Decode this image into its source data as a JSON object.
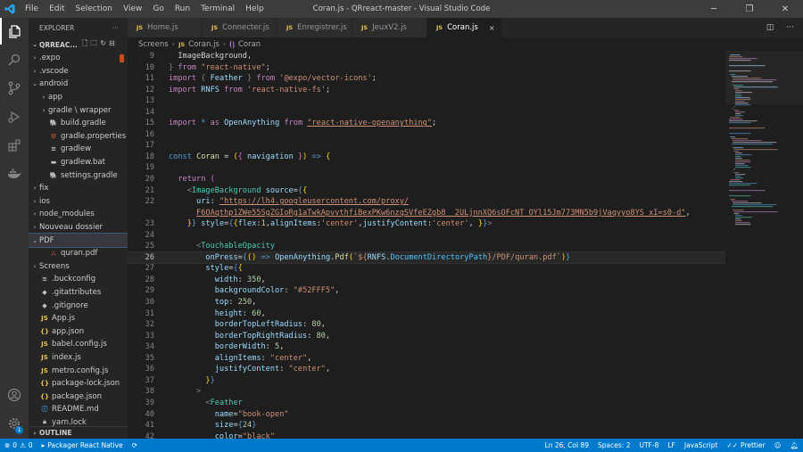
{
  "window": {
    "title": "Coran.js - QRreact-master - Visual Studio Code"
  },
  "menu": [
    "File",
    "Edit",
    "Selection",
    "View",
    "Go",
    "Run",
    "Terminal",
    "Help"
  ],
  "sidebar": {
    "header": "EXPLORER",
    "more": "···",
    "project": "QRREAC...",
    "items": [
      {
        "label": ".expo",
        "indent": 1,
        "kind": "folder",
        "open": false
      },
      {
        "label": ".vscode",
        "indent": 1,
        "kind": "folder",
        "open": false
      },
      {
        "label": "android",
        "indent": 1,
        "kind": "folder",
        "open": true
      },
      {
        "label": "app",
        "indent": 2,
        "kind": "folder",
        "open": false
      },
      {
        "label": "gradle \\ wrapper",
        "indent": 2,
        "kind": "folder",
        "open": false
      },
      {
        "label": "build.gradle",
        "indent": 2,
        "kind": "gradle"
      },
      {
        "label": "gradle.properties",
        "indent": 2,
        "kind": "gradle-props"
      },
      {
        "label": "gradlew",
        "indent": 2,
        "kind": "lines"
      },
      {
        "label": "gradlew.bat",
        "indent": 2,
        "kind": "bat"
      },
      {
        "label": "settings.gradle",
        "indent": 2,
        "kind": "gradle"
      },
      {
        "label": "fix",
        "indent": 1,
        "kind": "folder",
        "open": false
      },
      {
        "label": "ios",
        "indent": 1,
        "kind": "folder",
        "open": false
      },
      {
        "label": "node_modules",
        "indent": 1,
        "kind": "folder",
        "open": false
      },
      {
        "label": "Nouveau dossier",
        "indent": 1,
        "kind": "folder",
        "open": false
      },
      {
        "label": "PDF",
        "indent": 1,
        "kind": "folder",
        "open": true,
        "selected": true
      },
      {
        "label": "quran.pdf",
        "indent": 2,
        "kind": "pdf"
      },
      {
        "label": "Screens",
        "indent": 1,
        "kind": "folder",
        "open": false
      },
      {
        "label": ".buckconfig",
        "indent": 1,
        "kind": "lines"
      },
      {
        "label": ".gitattributes",
        "indent": 1,
        "kind": "git"
      },
      {
        "label": ".gitignore",
        "indent": 1,
        "kind": "git"
      },
      {
        "label": "App.js",
        "indent": 1,
        "kind": "js"
      },
      {
        "label": "app.json",
        "indent": 1,
        "kind": "json"
      },
      {
        "label": "babel.config.js",
        "indent": 1,
        "kind": "js"
      },
      {
        "label": "index.js",
        "indent": 1,
        "kind": "js"
      },
      {
        "label": "metro.config.js",
        "indent": 1,
        "kind": "js"
      },
      {
        "label": "package-lock.json",
        "indent": 1,
        "kind": "json"
      },
      {
        "label": "package.json",
        "indent": 1,
        "kind": "json"
      },
      {
        "label": "README.md",
        "indent": 1,
        "kind": "md"
      },
      {
        "label": "yarn.lock",
        "indent": 1,
        "kind": "yarn"
      }
    ],
    "outline": "OUTLINE"
  },
  "tabs": [
    {
      "label": "Home.js",
      "active": false
    },
    {
      "label": "Connecter.js",
      "active": false
    },
    {
      "label": "Enregistrer.js",
      "active": false
    },
    {
      "label": "JeuxV2.js",
      "active": false
    },
    {
      "label": "Coran.js",
      "active": true
    }
  ],
  "tab_icon_label": "JS",
  "tab_close": "×",
  "breadcrumb": [
    "Screens",
    "Coran.js",
    "Coran"
  ],
  "editor": {
    "current_line": 26,
    "lines": [
      {
        "n": "9",
        "html": "  ImageBackground,"
      },
      {
        "n": "10",
        "html": "<span class='p'>}</span> <span class='k'>from</span> <span class='s'>\"react-native\"</span>;"
      },
      {
        "n": "11",
        "html": "<span class='k'>import</span> <span class='p'>{</span> <span class='a'>Feather</span> <span class='p'>}</span> <span class='k'>from</span> <span class='s'>'@expo/vector-icons'</span>;"
      },
      {
        "n": "12",
        "html": "<span class='k'>import</span> <span class='a'>RNFS</span> <span class='k'>from</span> <span class='s'>'react-native-fs'</span>;"
      },
      {
        "n": "13",
        "html": ""
      },
      {
        "n": "14",
        "html": ""
      },
      {
        "n": "15",
        "html": "<span class='k'>import</span> <span class='kb'>*</span> <span class='k'>as</span> <span class='a'>OpenAnything</span> <span class='k'>from</span> <span class='s u'>\"react-native-openanything\"</span>;"
      },
      {
        "n": "16",
        "html": ""
      },
      {
        "n": "17",
        "html": ""
      },
      {
        "n": "18",
        "html": "<span class='kb'>const</span> <span class='f'>Coran</span> = <span class='y'>(</span><span class='pu'>{</span> <span class='a'>navigation</span> <span class='pu'>}</span><span class='y'>)</span> <span class='kb'>=&gt;</span> <span class='y'>{</span>"
      },
      {
        "n": "19",
        "html": ""
      },
      {
        "n": "20",
        "html": "  <span class='k'>return</span> <span class='pu'>(</span>"
      },
      {
        "n": "21",
        "html": "    <span class='p'>&lt;</span><span class='t'>ImageBackground</span> <span class='a'>source</span>=<span class='kb'>{</span><span class='y'>{</span>"
      },
      {
        "n": "22",
        "html": "      <span class='a'>uri</span>: <span class='s u'>\"https://lh4.googleusercontent.com/proxy/</span>"
      },
      {
        "n": "",
        "html": "      <span class='s u'>F6OAqthp1ZWe55SgZGIoRg1aTwkApvvthfiBexPKw6nzqSVfeEZgb8__2ULjnnXQ6sOFcNT_OYl15Jm773MN5b9jVaqyyo8YS_xI=s0-d\"</span>,"
      },
      {
        "n": "23",
        "html": "    <span class='y'>}</span><span class='kb'>}</span> <span class='a'>style</span>=<span class='kb'>{</span><span class='y'>{</span><span class='a'>flex</span>:<span class='n'>1</span>,<span class='a'>alignItems</span>:<span class='s'>'center'</span>,<span class='a'>justifyContent</span>:<span class='s'>'center'</span>, <span class='y'>}</span><span class='kb'>}</span><span class='p'>&gt;</span>"
      },
      {
        "n": "24",
        "html": ""
      },
      {
        "n": "25",
        "html": "      <span class='p'>&lt;</span><span class='t'>TouchableOpacity</span>"
      },
      {
        "n": "26",
        "html": "        <span class='a'>onPress</span>=<span class='kb'>{</span><span class='y'>()</span> <span class='kb'>=&gt;</span> <span class='a'>OpenAnything</span>.<span class='f'>Pdf</span><span class='y'>(</span><span class='s'>`${</span><span class='a'>RNFS</span>.<span class='c'>DocumentDirectoryPath</span><span class='s'>}/PDF/quran.pdf`</span><span class='y'>)</span><span class='kb'>}</span>"
      },
      {
        "n": "27",
        "html": "        <span class='a'>style</span>=<span class='kb'>{</span><span class='y'>{</span>"
      },
      {
        "n": "28",
        "html": "          <span class='a'>width</span>: <span class='n'>350</span>,"
      },
      {
        "n": "29",
        "html": "          <span class='a'>backgroundColor</span>: <span class='s'>\"#52FFF5\"</span>,"
      },
      {
        "n": "30",
        "html": "          <span class='a'>top</span>: <span class='n'>250</span>,"
      },
      {
        "n": "31",
        "html": "          <span class='a'>height</span>: <span class='n'>60</span>,"
      },
      {
        "n": "32",
        "html": "          <span class='a'>borderTopLeftRadius</span>: <span class='n'>80</span>,"
      },
      {
        "n": "33",
        "html": "          <span class='a'>borderTopRightRadius</span>: <span class='n'>80</span>,"
      },
      {
        "n": "34",
        "html": "          <span class='a'>borderWidth</span>: <span class='n'>5</span>,"
      },
      {
        "n": "35",
        "html": "          <span class='a'>alignItems</span>: <span class='s'>\"center\"</span>,"
      },
      {
        "n": "36",
        "html": "          <span class='a'>justifyContent</span>: <span class='s'>\"center\"</span>,"
      },
      {
        "n": "37",
        "html": "        <span class='y'>}</span><span class='kb'>}</span>"
      },
      {
        "n": "38",
        "html": "      <span class='p'>&gt;</span>"
      },
      {
        "n": "39",
        "html": "        <span class='p'>&lt;</span><span class='t'>Feather</span>"
      },
      {
        "n": "40",
        "html": "          <span class='a'>name</span>=<span class='s'>\"book-open\"</span>"
      },
      {
        "n": "41",
        "html": "          <span class='a'>size</span>=<span class='kb'>{</span><span class='n'>24</span><span class='kb'>}</span>"
      },
      {
        "n": "42",
        "html": "          <span class='a'>color</span>=<span class='s'>\"black\"</span>"
      }
    ]
  },
  "statusbar": {
    "errors": "0",
    "warnings": "0",
    "packager": "Packager React Native",
    "position": "Ln 26, Col 89",
    "spaces": "Spaces: 2",
    "encoding": "UTF-8",
    "eol": "LF",
    "language": "JavaScript",
    "prettier": "Prettier"
  },
  "colors": {
    "accent": "#007acc",
    "titlebar": "#3c3c3c",
    "activitybar": "#333333",
    "sidebar": "#252526",
    "editor": "#1e1e1e"
  }
}
